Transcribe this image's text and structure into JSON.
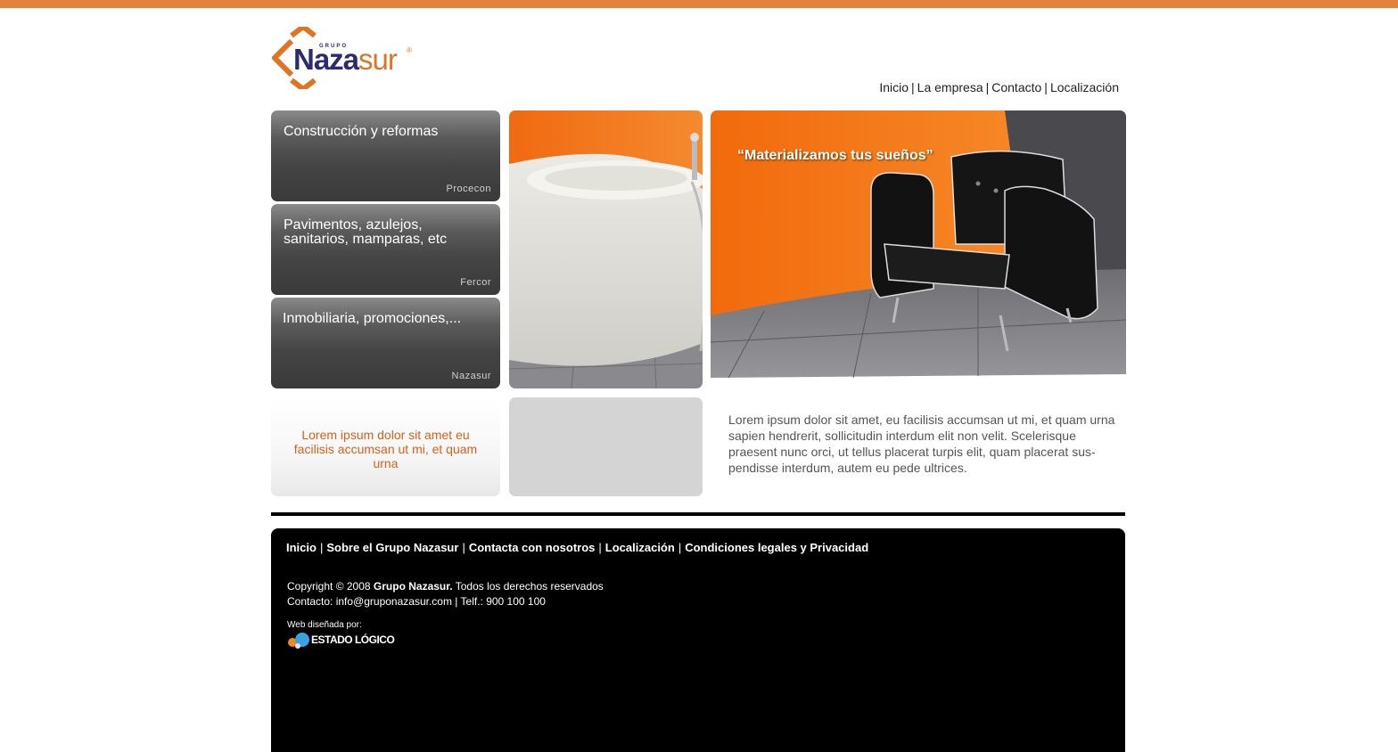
{
  "brand": {
    "logo_small": "GRUPO",
    "logo_main": "Naza",
    "logo_accent": "sur",
    "reg": "®",
    "orange": "#e5813a",
    "navy": "#2c2b6d"
  },
  "topnav": {
    "items": [
      "Inicio",
      "La empresa",
      "Contacto",
      "Localización"
    ]
  },
  "tiles": [
    {
      "title": "Construcción y reformas",
      "sub": "Procecon"
    },
    {
      "title": "Pavimentos, azulejos, sanitarios, mamparas, etc",
      "sub": "Fercor"
    },
    {
      "title": "Inmobiliaria, promociones,...",
      "sub": "Nazasur"
    }
  ],
  "hero": {
    "slogan": "“Materializamos tus sueños”"
  },
  "promo": {
    "text": "Lorem ipsum dolor sit amet  eu facilisis accumsan ut mi, et quam urna"
  },
  "body": {
    "text": "Lorem ipsum dolor sit amet, eu facilisis accumsan ut mi, et quam urna sapien hendrerit, sollicitudin interdum elit non velit. Scelerisque praesent nunc orci, ut tellus placerat turpis elit, quam placerat sus-pendisse interdum, autem eu pede ultrices."
  },
  "footer": {
    "nav": [
      "Inicio",
      "Sobre el Grupo Nazasur",
      "Contacta con nosotros",
      "Localización",
      "Condiciones legales y Privacidad"
    ],
    "copyright_prefix": "Copyright © 2008",
    "copyright_brand": "Grupo Nazasur.",
    "copyright_suffix": "Todos los derechos reservados",
    "contact": "Contacto: info@gruponazasur.com | Telf.: 900 100 100",
    "designed_by": "Web diseñada por:",
    "designer": "ESTADO LÓGICO"
  }
}
